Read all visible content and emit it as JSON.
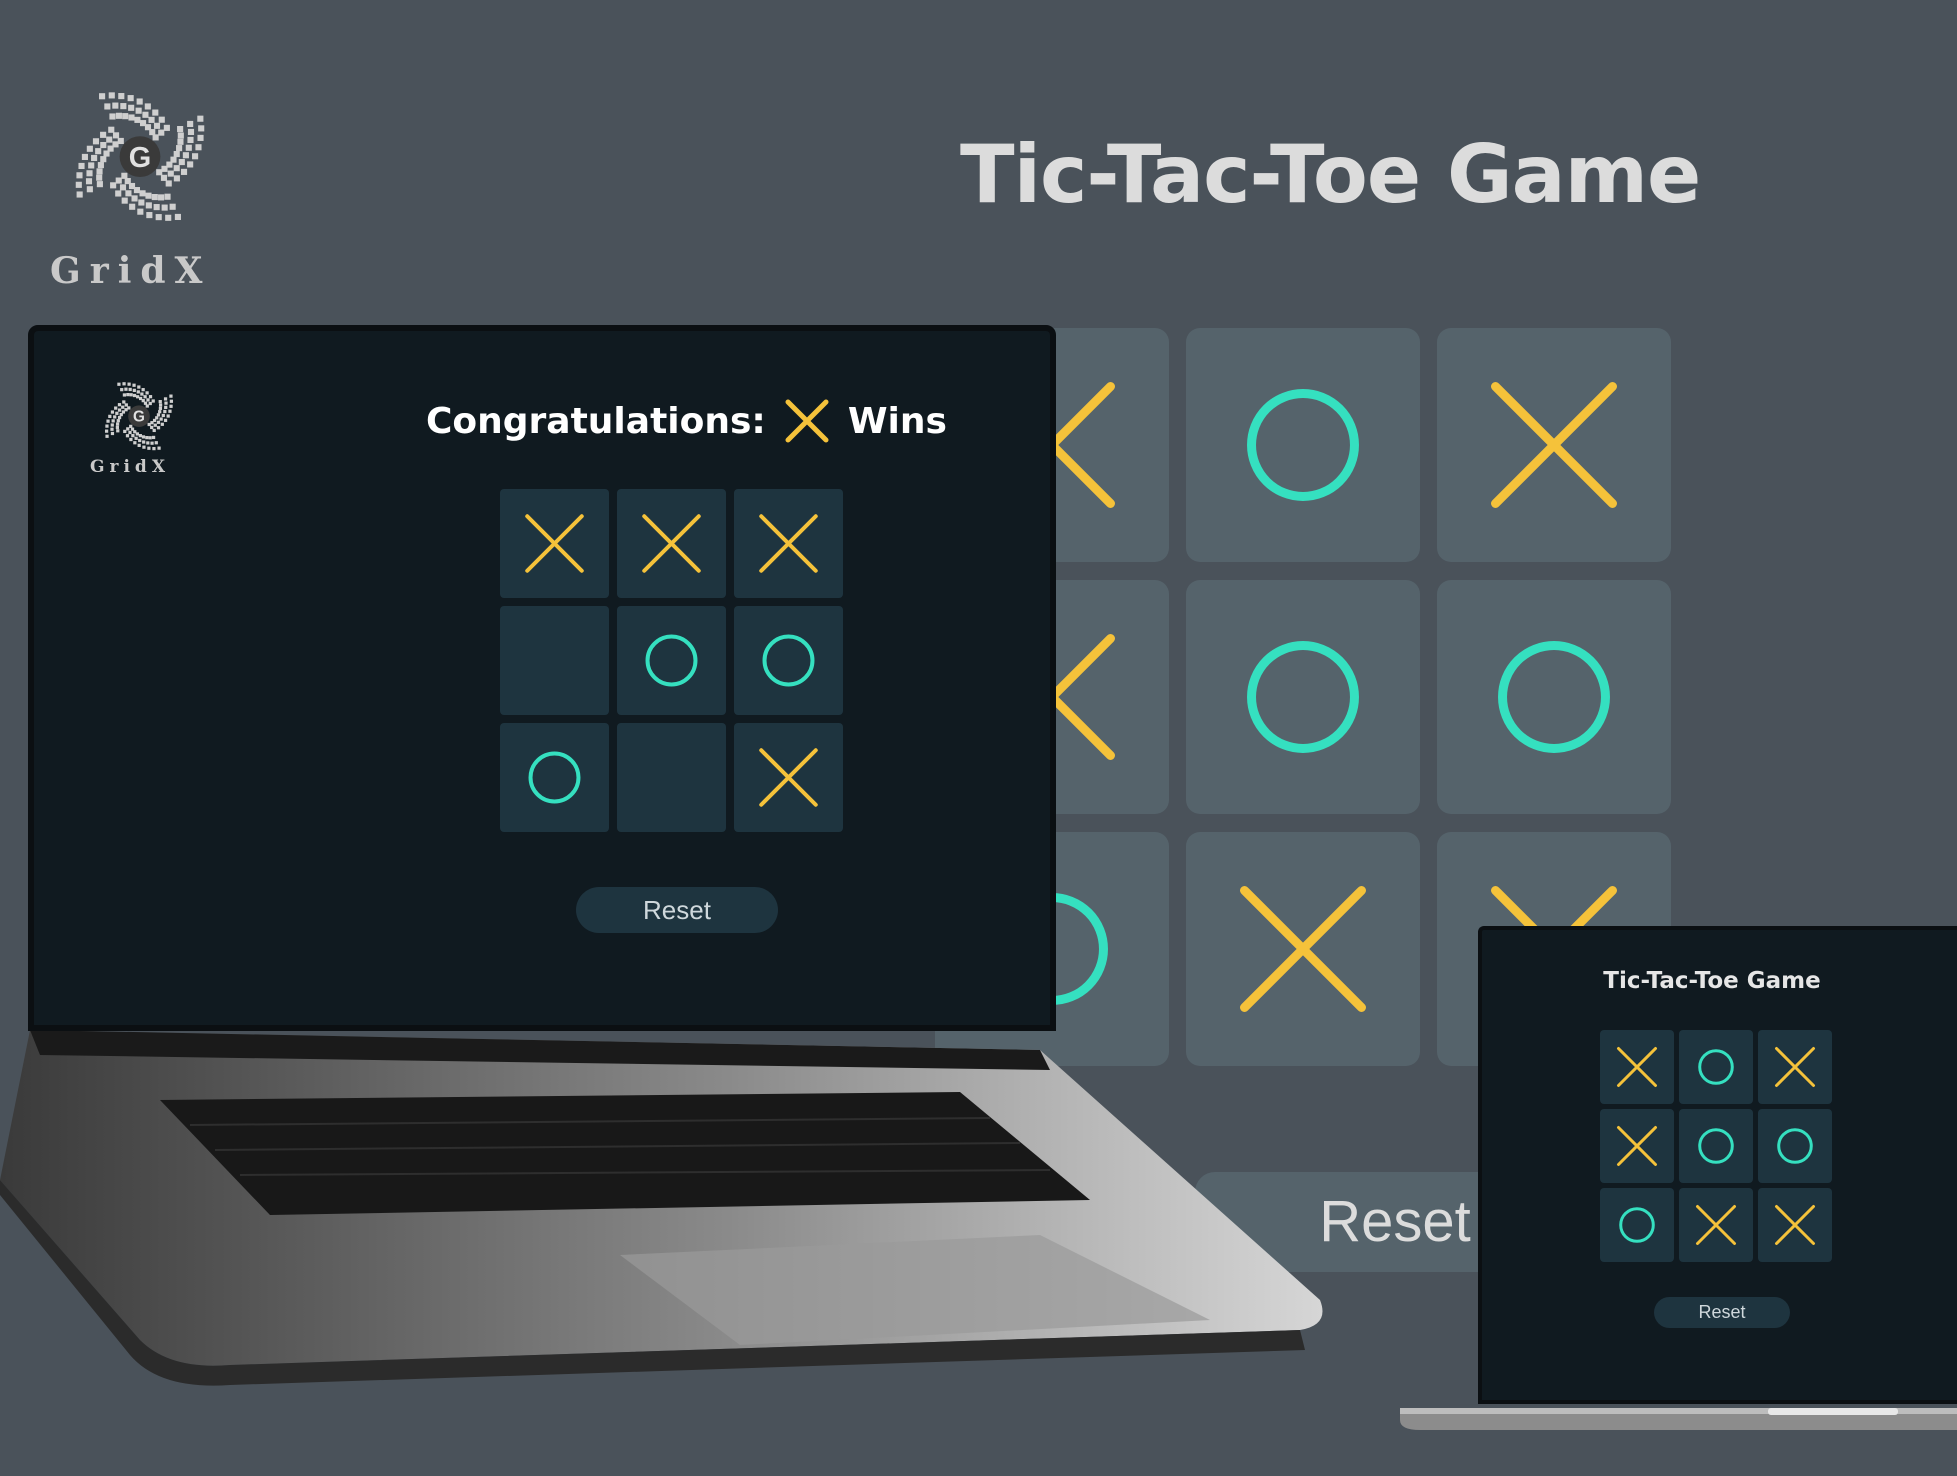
{
  "brand": {
    "name": "GridX",
    "logo_letter": "G"
  },
  "background_game": {
    "title": "Tic-Tac-Toe Game",
    "board": [
      "X",
      "O",
      "X",
      "X",
      "O",
      "O",
      "O",
      "X",
      "X"
    ],
    "reset_label": "Reset"
  },
  "laptop_game": {
    "brand_name": "GridX",
    "logo_letter": "G",
    "status": {
      "prefix": "Congratulations:",
      "winner": "X",
      "suffix": "Wins"
    },
    "board": [
      "X",
      "X",
      "X",
      "",
      "O",
      "O",
      "O",
      "",
      "X"
    ],
    "reset_label": "Reset"
  },
  "small_laptop_game": {
    "title": "Tic-Tac-Toe Game",
    "board": [
      "X",
      "O",
      "X",
      "X",
      "O",
      "O",
      "O",
      "X",
      "X"
    ],
    "reset_label": "Reset"
  },
  "colors": {
    "x_mark": "#f5c23a",
    "o_mark": "#35e0c0",
    "cell": "#1e343f",
    "bg_cell": "#55636b",
    "screen": "#101a20",
    "page_background": "#4a525a"
  },
  "icons": {
    "x_mark": "x-mark-icon",
    "o_mark": "o-mark-icon",
    "logo": "gridx-logo-icon"
  }
}
